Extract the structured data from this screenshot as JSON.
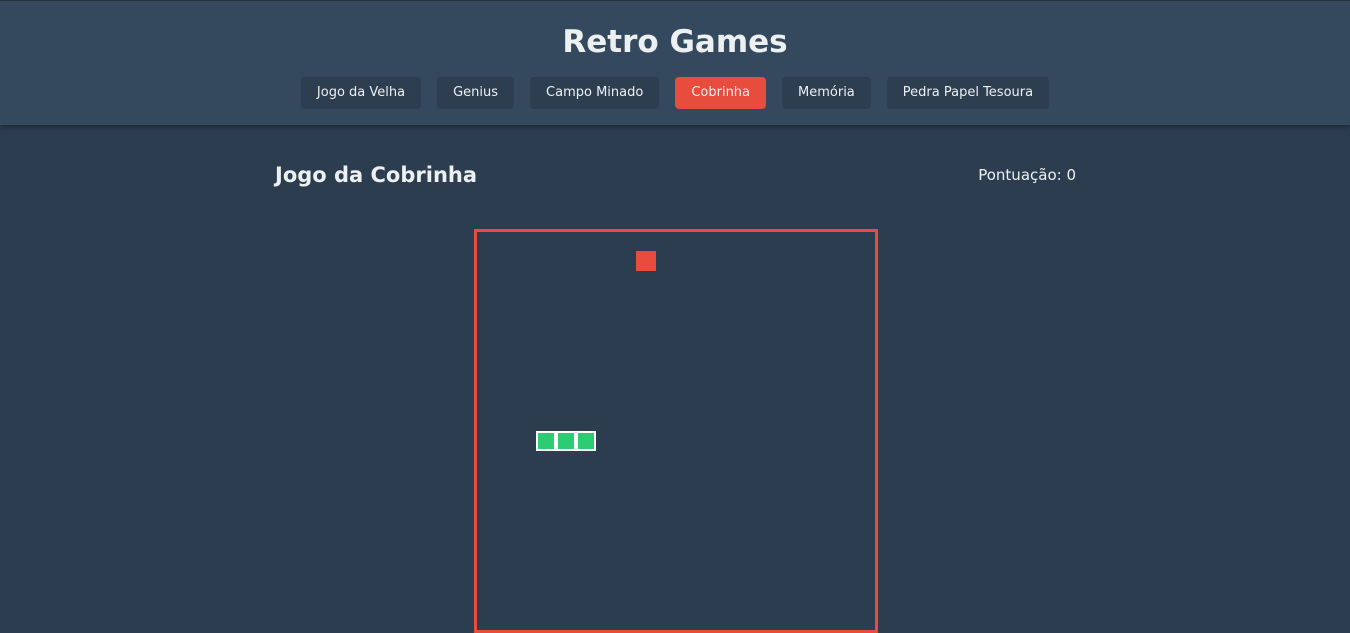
{
  "header": {
    "title": "Retro Games",
    "nav": [
      {
        "label": "Jogo da Velha",
        "active": false
      },
      {
        "label": "Genius",
        "active": false
      },
      {
        "label": "Campo Minado",
        "active": false
      },
      {
        "label": "Cobrinha",
        "active": true
      },
      {
        "label": "Memória",
        "active": false
      },
      {
        "label": "Pedra Papel Tesoura",
        "active": false
      }
    ]
  },
  "game": {
    "title": "Jogo da Cobrinha",
    "score_text": "Pontuação: 0",
    "grid_cells": 20,
    "food": {
      "col": 8,
      "row": 1
    },
    "snake": [
      {
        "col": 5,
        "row": 10
      },
      {
        "col": 4,
        "row": 10
      },
      {
        "col": 3,
        "row": 10
      }
    ]
  },
  "colors": {
    "background": "#2d3d50",
    "header": "#34495e",
    "button": "#2c3e50",
    "accent": "#e74c3c",
    "snake": "#2ecc71"
  }
}
